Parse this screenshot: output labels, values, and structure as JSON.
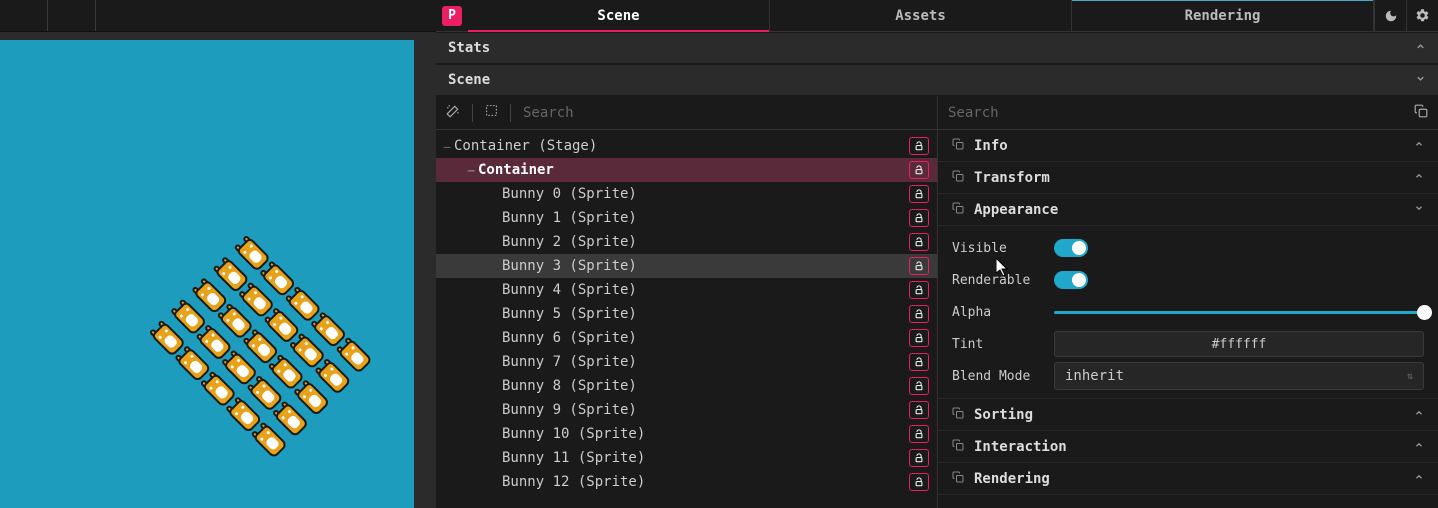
{
  "tabs": {
    "scene": "Scene",
    "assets": "Assets",
    "rendering": "Rendering"
  },
  "sections": {
    "stats": "Stats",
    "scene": "Scene"
  },
  "search": {
    "placeholder_left": "Search",
    "placeholder_right": "Search"
  },
  "tree": {
    "root": "Container (Stage)",
    "container": "Container",
    "items": [
      "Bunny 0 (Sprite)",
      "Bunny 1 (Sprite)",
      "Bunny 2 (Sprite)",
      "Bunny 3 (Sprite)",
      "Bunny 4 (Sprite)",
      "Bunny 5 (Sprite)",
      "Bunny 6 (Sprite)",
      "Bunny 7 (Sprite)",
      "Bunny 8 (Sprite)",
      "Bunny 9 (Sprite)",
      "Bunny 10 (Sprite)",
      "Bunny 11 (Sprite)",
      "Bunny 12 (Sprite)"
    ],
    "selected_index": -1,
    "hovered_index": 3
  },
  "props": {
    "sections": {
      "info": "Info",
      "transform": "Transform",
      "appearance": "Appearance",
      "sorting": "Sorting",
      "interaction": "Interaction",
      "rendering": "Rendering"
    },
    "appearance": {
      "visible_label": "Visible",
      "renderable_label": "Renderable",
      "alpha_label": "Alpha",
      "tint_label": "Tint",
      "tint_value": "#ffffff",
      "blend_label": "Blend Mode",
      "blend_value": "inherit"
    }
  },
  "logo_letter": "P"
}
